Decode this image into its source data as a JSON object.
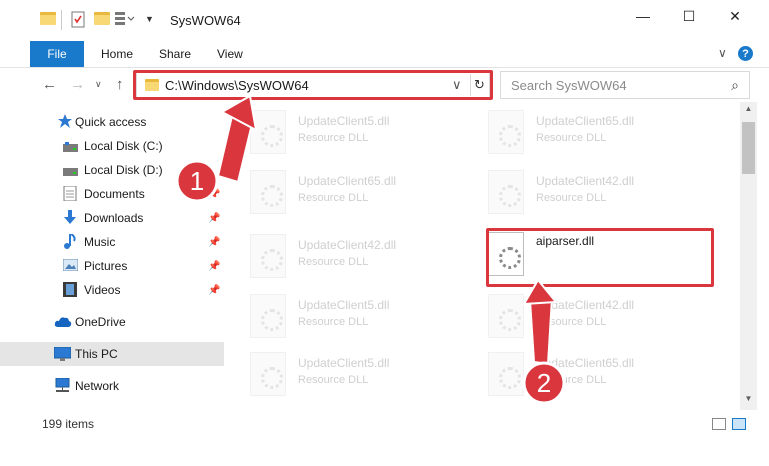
{
  "window": {
    "title": "SysWOW64",
    "minimize_glyph": "—",
    "maximize_glyph": "☐",
    "close_glyph": "✕"
  },
  "quick_access_toolbar": {
    "icons": [
      "folder-icon",
      "properties-icon",
      "new-folder-icon",
      "customize-icon"
    ]
  },
  "ribbon": {
    "tabs": [
      {
        "label": "File",
        "active": true
      },
      {
        "label": "Home"
      },
      {
        "label": "Share"
      },
      {
        "label": "View"
      }
    ],
    "expand_glyph": "∨",
    "help_glyph": "?"
  },
  "address_bar": {
    "path": "C:\\Windows\\SysWOW64",
    "search_placeholder": "Search SysWOW64"
  },
  "sidebar": {
    "items": [
      {
        "label": "Quick access",
        "icon": "star-icon"
      },
      {
        "label": "Local Disk (C:)",
        "icon": "drive-icon"
      },
      {
        "label": "Local Disk (D:)",
        "icon": "drive-icon"
      },
      {
        "label": "Documents",
        "icon": "documents-icon",
        "pinned": true
      },
      {
        "label": "Downloads",
        "icon": "downloads-icon",
        "pinned": true
      },
      {
        "label": "Music",
        "icon": "music-icon",
        "pinned": true
      },
      {
        "label": "Pictures",
        "icon": "pictures-icon",
        "pinned": true
      },
      {
        "label": "Videos",
        "icon": "videos-icon",
        "pinned": true
      },
      {
        "label": "OneDrive",
        "icon": "cloud-icon"
      },
      {
        "label": "This PC",
        "icon": "computer-icon",
        "selected": true
      },
      {
        "label": "Network",
        "icon": "network-icon"
      }
    ]
  },
  "files": {
    "left": [
      {
        "name": "UpdateClient5.dll",
        "type": "Resource DLL"
      },
      {
        "name": "UpdateClient65.dll",
        "type": "Resource DLL"
      },
      {
        "name": "UpdateClient42.dll",
        "type": "Resource DLL"
      },
      {
        "name": "UpdateClient5.dll",
        "type": "Resource DLL"
      },
      {
        "name": "UpdateClient5.dll",
        "type": "Resource DLL"
      }
    ],
    "right": [
      {
        "name": "UpdateClient65.dll",
        "type": "Resource DLL"
      },
      {
        "name": "UpdateClient42.dll",
        "type": "Resource DLL"
      },
      {
        "name": "aiparser.dll",
        "type": ""
      },
      {
        "name": "UpdateClient42.dll",
        "type": "Resource DLL"
      },
      {
        "name": "UpdateClient65.dll",
        "type": "Resource DLL"
      }
    ]
  },
  "status": {
    "item_count": "199 items"
  },
  "annotations": {
    "step1": "1",
    "step2": "2",
    "color": "#d9363e"
  }
}
